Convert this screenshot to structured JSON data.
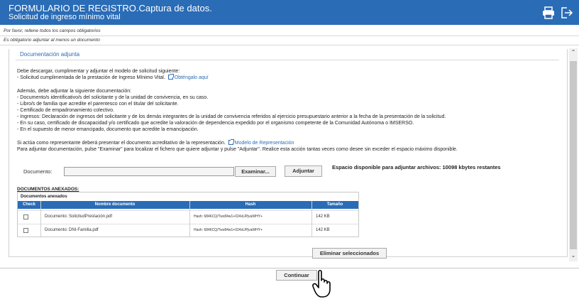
{
  "header": {
    "title": "FORMULARIO DE REGISTRO.Captura de datos.",
    "subtitle": "Solicitud de ingreso mínimo vital",
    "print_icon": "printer-icon",
    "exit_icon": "exit-icon"
  },
  "notes": {
    "fill_all": "Por favor, rellene todos los campos obligatorios",
    "attach_required": "Es obligatorio adjuntar al menos un documento"
  },
  "section": {
    "legend": "Documentación adjunta",
    "intro": "Debe descargar, cumplimentar y adjuntar el modelo de solicitud siguiente:",
    "form_item": "- Solicitud cumplimentada de la prestación de Ingreso Mínimo Vital.",
    "form_link": "Obténgalo aquí",
    "also_attach": "Además, debe adjuntar la siguiente documentación:",
    "doc_list": [
      "- Documento/s identificativo/s del solicitante y de la unidad de convivencia, en su caso.",
      "- Libro/s de familia que acredite el parentesco con el titular del solicitante.",
      "- Certificado de empadronamiento colectivo.",
      "- Ingresos: Declaración de ingresos del solicitante y de los demás integrantes de la unidad de convivencia referidos al ejercicio presupuestario anterior a la fecha de la presentación de la solicitud.",
      "- En su caso, certificado de discapacidad y/o certificado que acredite la valoración de dependencia expedido por el organismo competente de la Comunidad Autónoma o IMSERSO.",
      "- En el supuesto de menor emancipado, documento que acredite la emancipación."
    ],
    "representative": "Si actúa como representante deberá presentar el documento acreditativo de la representación.",
    "representative_link": "Modelo de Representación",
    "attach_instructions": "Para adjuntar documentación, pulse \"Examinar\" para localizar el fichero que quiere adjuntar y pulse \"Adjuntar\". Realice esta acción tantas veces como desee sin exceder el espacio máximo disponible."
  },
  "upload": {
    "label": "Documento:",
    "file_value": "",
    "browse_button": "Examinar...",
    "attach_button": "Adjuntar",
    "space_available": "Espacio disponible para adjuntar archivos: 10098 kbytes restantes"
  },
  "docs": {
    "title": "DOCUMENTOS ANEXADOS:",
    "caption": "Documentos anexados",
    "columns": [
      "Check",
      "Nombre documento",
      "Hash",
      "Tamaño"
    ],
    "rows": [
      {
        "name": "Documento: SolicitudPrestación.pdf",
        "hash": "Hash: 6846CQ/Twx84w1+024sUPjvaWHY+",
        "size": "142 KB"
      },
      {
        "name": "Documento: DNI-Familia.pdf",
        "hash": "Hash: 6846CQ/Twx84w1+024sUPjvaWHY+",
        "size": "142 KB"
      }
    ],
    "delete_button": "Eliminar seleccionados"
  },
  "footer": {
    "continue_button": "Continuar"
  }
}
